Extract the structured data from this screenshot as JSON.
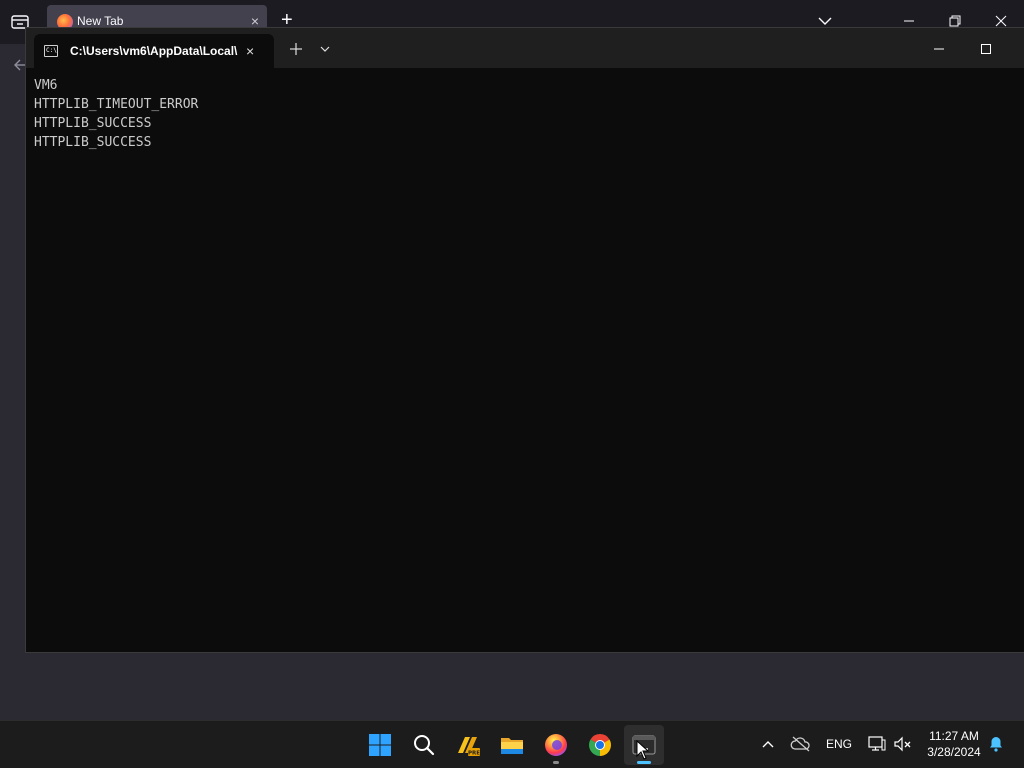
{
  "firefox": {
    "tab_title": "New Tab",
    "tab_close": "×",
    "new_tab": "+"
  },
  "terminal": {
    "tab_title": "C:\\Users\\vm6\\AppData\\Local\\",
    "tab_close": "×",
    "output_lines": [
      "VM6",
      "HTTPLIB_TIMEOUT_ERROR",
      "HTTPLIB_SUCCESS",
      "HTTPLIB_SUCCESS"
    ]
  },
  "taskbar": {
    "apps": [
      "start-icon",
      "search-icon",
      "power-automate-icon",
      "file-explorer-icon",
      "firefox-icon",
      "chrome-icon",
      "terminal-icon"
    ],
    "tray": {
      "language": "ENG",
      "time": "11:27 AM",
      "date": "3/28/2024"
    }
  },
  "colors": {
    "terminal_bg": "#0c0c0c",
    "terminal_text": "#cccccc",
    "taskbar_bg": "#1c1c1c",
    "active_indicator": "#4cc2ff"
  }
}
